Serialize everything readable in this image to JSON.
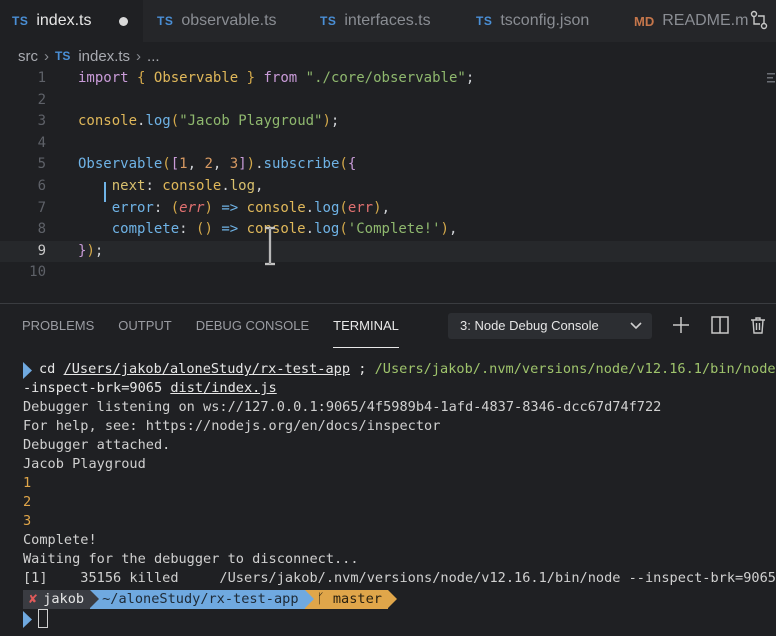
{
  "tabs": [
    {
      "icon": "TS",
      "label": "index.ts",
      "active": true,
      "modified": true
    },
    {
      "icon": "TS",
      "label": "observable.ts"
    },
    {
      "icon": "TS",
      "label": "interfaces.ts"
    },
    {
      "icon": "TS",
      "label": "tsconfig.json"
    },
    {
      "icon": "MD",
      "label": "README.m"
    }
  ],
  "breadcrumb": {
    "folder": "src",
    "file_icon": "TS",
    "file": "index.ts",
    "more": "..."
  },
  "editor": {
    "line_numbers": [
      "1",
      "2",
      "3",
      "4",
      "5",
      "6",
      "7",
      "8",
      "9",
      "10"
    ],
    "lines": [
      "import { Observable } from \"./core/observable\";",
      "",
      "console.log(\"Jacob Playgroud\");",
      "",
      "Observable([1, 2, 3]).subscribe({",
      "    next: console.log,",
      "    error: (err) => console.log(err),",
      "    complete: () => console.log('Complete!'),",
      "});",
      ""
    ]
  },
  "panel": {
    "tabs": [
      "PROBLEMS",
      "OUTPUT",
      "DEBUG CONSOLE",
      "TERMINAL"
    ],
    "active_tab": "TERMINAL",
    "terminal_select": "3: Node Debug Console"
  },
  "terminal": {
    "cmd_cd": "cd",
    "cmd_path": "/Users/jakob/aloneStudy/rx-test-app",
    "cmd_sep": ";",
    "cmd_node": "/Users/jakob/.nvm/versions/node/v12.16.1/bin/node -",
    "cmd_cont_flag": "-inspect-brk=9065",
    "cmd_cont_file": "dist/index.js",
    "out": [
      "Debugger listening on ws://127.0.0.1:9065/4f5989b4-1afd-4837-8346-dcc67d74f722",
      "For help, see: https://nodejs.org/en/docs/inspector",
      "Debugger attached.",
      "Jacob Playgroud"
    ],
    "nums": [
      "1",
      "2",
      "3"
    ],
    "out2": [
      "Complete!",
      "Waiting for the debugger to disconnect...",
      "[1]    35156 killed     /Users/jakob/.nvm/versions/node/v12.16.1/bin/node --inspect-brk=9065"
    ],
    "prompt": {
      "status": "✘",
      "user": "jakob",
      "dir": "~/aloneStudy/rx-test-app",
      "branch_icon": "ᚴ",
      "branch": "master"
    },
    "cursor": "▯"
  },
  "colors": {
    "accent": "#6fa9e0",
    "branch": "#e0a64a",
    "bg": "#1f2023"
  }
}
